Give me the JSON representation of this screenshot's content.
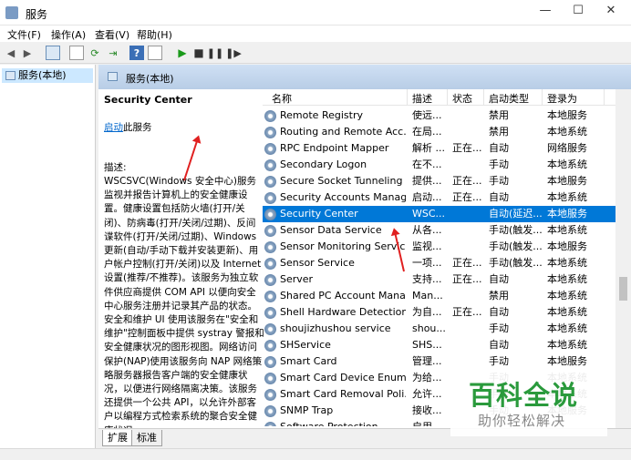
{
  "window": {
    "title": "服务"
  },
  "menu": [
    "文件(F)",
    "操作(A)",
    "查看(V)",
    "帮助(H)"
  ],
  "tree": {
    "item": "服务(本地)"
  },
  "panel_header": "服务(本地)",
  "detail": {
    "service_name": "Security Center",
    "start_link": "启动",
    "start_suffix": "此服务",
    "desc_label": "描述:",
    "desc_text": "WSCSVC(Windows 安全中心)服务监视并报告计算机上的安全健康设置。健康设置包括防火墙(打开/关闭)、防病毒(打开/关闭/过期)、反间谍软件(打开/关闭/过期)、Windows 更新(自动/手动下载并安装更新)、用户帐户控制(打开/关闭)以及 Internet 设置(推荐/不推荐)。该服务为独立软件供应商提供 COM API 以便向安全中心服务注册并记录其产品的状态。安全和维护 UI 使用该服务在\"安全和维护\"控制面板中提供 systray 警报和安全健康状况的图形视图。网络访问保护(NAP)使用该服务向 NAP 网络策略服务器报告客户端的安全健康状况，以便进行网络隔离决策。该服务还提供一个公共 API，以允许外部客户以编程方式检索系统的聚合安全健康状况。"
  },
  "columns": [
    "名称",
    "描述",
    "状态",
    "启动类型",
    "登录为"
  ],
  "rows": [
    {
      "name": "Remote Registry",
      "desc": "使远...",
      "status": "",
      "start": "禁用",
      "logon": "本地服务"
    },
    {
      "name": "Routing and Remote Acc...",
      "desc": "在局...",
      "status": "",
      "start": "禁用",
      "logon": "本地系统"
    },
    {
      "name": "RPC Endpoint Mapper",
      "desc": "解析 ...",
      "status": "正在...",
      "start": "自动",
      "logon": "网络服务"
    },
    {
      "name": "Secondary Logon",
      "desc": "在不...",
      "status": "",
      "start": "手动",
      "logon": "本地系统"
    },
    {
      "name": "Secure Socket Tunneling ...",
      "desc": "提供...",
      "status": "正在...",
      "start": "手动",
      "logon": "本地服务"
    },
    {
      "name": "Security Accounts Manag...",
      "desc": "启动...",
      "status": "正在...",
      "start": "自动",
      "logon": "本地系统"
    },
    {
      "name": "Security Center",
      "desc": "WSC...",
      "status": "",
      "start": "自动(延迟...",
      "logon": "本地服务"
    },
    {
      "name": "Sensor Data Service",
      "desc": "从各...",
      "status": "",
      "start": "手动(触发...",
      "logon": "本地系统"
    },
    {
      "name": "Sensor Monitoring Service",
      "desc": "监视...",
      "status": "",
      "start": "手动(触发...",
      "logon": "本地服务"
    },
    {
      "name": "Sensor Service",
      "desc": "一项...",
      "status": "正在...",
      "start": "手动(触发...",
      "logon": "本地系统"
    },
    {
      "name": "Server",
      "desc": "支持...",
      "status": "正在...",
      "start": "自动",
      "logon": "本地系统"
    },
    {
      "name": "Shared PC Account Mana...",
      "desc": "Man...",
      "status": "",
      "start": "禁用",
      "logon": "本地系统"
    },
    {
      "name": "Shell Hardware Detection",
      "desc": "为自...",
      "status": "正在...",
      "start": "自动",
      "logon": "本地系统"
    },
    {
      "name": "shoujizhushou service",
      "desc": "shou...",
      "status": "",
      "start": "手动",
      "logon": "本地系统"
    },
    {
      "name": "SHService",
      "desc": "SHS...",
      "status": "",
      "start": "自动",
      "logon": "本地系统"
    },
    {
      "name": "Smart Card",
      "desc": "管理...",
      "status": "",
      "start": "手动",
      "logon": "本地服务"
    },
    {
      "name": "Smart Card Device Enum...",
      "desc": "为给...",
      "status": "",
      "start": "手动",
      "logon": "本地系统"
    },
    {
      "name": "Smart Card Removal Poli...",
      "desc": "允许...",
      "status": "",
      "start": "手动",
      "logon": "本地系统"
    },
    {
      "name": "SNMP Trap",
      "desc": "接收...",
      "status": "",
      "start": "手动",
      "logon": "本地服务"
    },
    {
      "name": "Software Protection",
      "desc": "启用...",
      "status": "",
      "start": "",
      "logon": ""
    }
  ],
  "selected_row": 6,
  "tabs": [
    "扩展",
    "标准"
  ],
  "watermark": {
    "main": "百科全说",
    "sub": "助你轻松解决"
  },
  "colors": {
    "selection": "#0078d7",
    "arrow": "#e02020",
    "watermark_green": "#2a9a3c"
  }
}
